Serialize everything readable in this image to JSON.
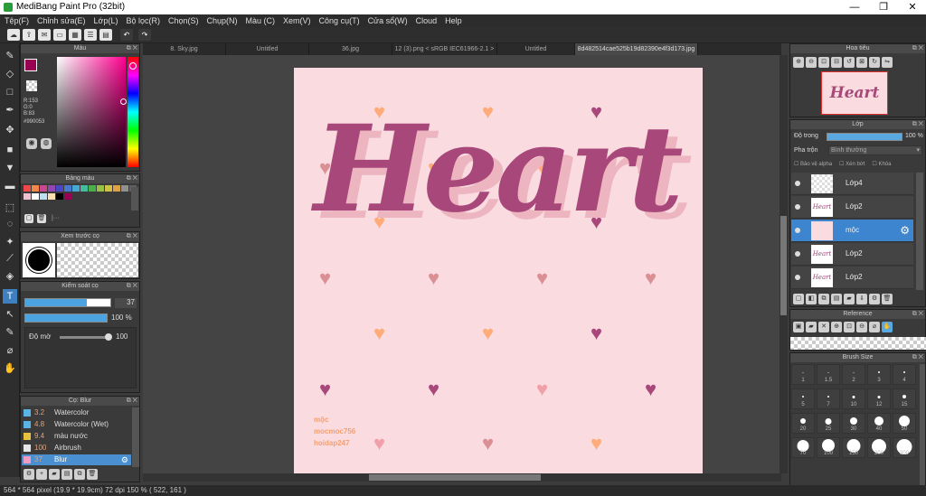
{
  "titlebar": {
    "title": "MediBang Paint Pro (32bit)",
    "min": "—",
    "max": "❐",
    "close": "✕"
  },
  "menu": [
    "Tệp(F)",
    "Chỉnh sửa(E)",
    "Lớp(L)",
    "Bộ lọc(R)",
    "Chọn(S)",
    "Chụp(N)",
    "Màu (C)",
    "Xem(V)",
    "Công cụ(T)",
    "Cửa sổ(W)",
    "Cloud",
    "Help"
  ],
  "tabs": [
    "8. Sky.jpg",
    "Untitled",
    "36.jpg",
    "12 (3).png < sRGB IEC61966-2.1 >",
    "Untitled",
    "8d482514cae525b19d82390e4f3d173.jpg"
  ],
  "color_panel": {
    "title": "Màu",
    "r": "R:153",
    "g": "G:0",
    "b": "B:83",
    "hex": "#990053",
    "fg": "#990053"
  },
  "palette_panel": {
    "title": "Bảng màu",
    "dots": "|···",
    "colors": [
      "#f04848",
      "#f08848",
      "#c84890",
      "#9048b0",
      "#4848c0",
      "#4878d0",
      "#48a8d0",
      "#48b8a0",
      "#48b048",
      "#98c048",
      "#d0c048",
      "#e0a048",
      "#909090",
      "#606060",
      "#f0c0d0",
      "#ffffff",
      "#c0e0f0",
      "#f8e0b0",
      "#000000",
      "#990053"
    ]
  },
  "brush_preview": {
    "title": "Xem trước cọ"
  },
  "brush_ctrl": {
    "title": "Kiểm soát cọ",
    "size": "37",
    "opacity": "100 %",
    "opacity_fill": 1.0,
    "size_fill": 0.72,
    "blur_label": "Độ mờ",
    "blur_value": "100"
  },
  "brushes": {
    "title": "Cọ: Blur",
    "items": [
      {
        "size": "3.2",
        "name": "Watercolor",
        "color": "#5ab4e6"
      },
      {
        "size": "4.8",
        "name": "Watercolor (Wet)",
        "color": "#5ab4e6"
      },
      {
        "size": "9.4",
        "name": "màu nước",
        "color": "#e8c040"
      },
      {
        "size": "100",
        "name": "Airbrush",
        "color": "#e6e6e6"
      },
      {
        "size": "37",
        "name": "Blur",
        "color": "#f09cc0"
      }
    ]
  },
  "canvas": {
    "title_text": "Heart",
    "watermark": [
      "mộc",
      "mocmoc756",
      "hoidap247"
    ],
    "bg": "#f9dbe0"
  },
  "navigator": {
    "title": "Hoa tiêu",
    "preview_text": "Heart"
  },
  "layer_panel": {
    "title": "Lớp",
    "opacity_label": "Độ trong",
    "opacity_value": "100 %",
    "opacity_fill": 1.0,
    "blend_label": "Pha trộn",
    "blend_value": "Bình thường",
    "alpha_label": "Bảo vệ alpha",
    "clip_label": "Xén bớt",
    "lock_label": "Khóa",
    "layers": [
      {
        "name": "Lớp4",
        "selected": false
      },
      {
        "name": "Lớp2",
        "selected": false
      },
      {
        "name": "mộc",
        "selected": true
      },
      {
        "name": "Lớp2",
        "selected": false
      },
      {
        "name": "Lớp2",
        "selected": false
      }
    ]
  },
  "reference": {
    "title": "Reference"
  },
  "brush_size": {
    "title": "Brush Size",
    "sizes": [
      "1",
      "1.5",
      "2",
      "3",
      "4",
      "5",
      "7",
      "10",
      "12",
      "15",
      "20",
      "25",
      "30",
      "40",
      "50",
      "70",
      "100",
      "150",
      "200",
      "300"
    ]
  },
  "status": {
    "text": "564 * 564 pixel   (19.9 * 19.9cm)   72 dpi   150 %   ( 522, 161 )"
  }
}
